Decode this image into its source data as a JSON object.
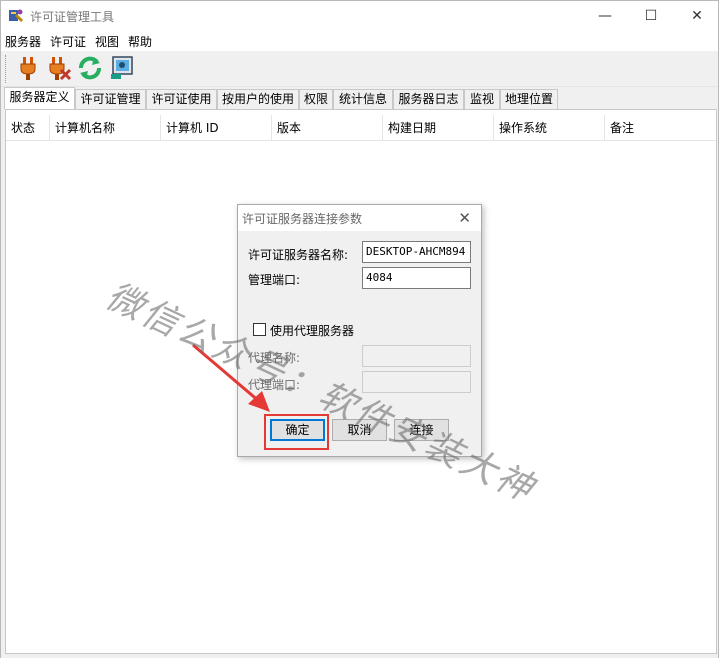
{
  "window": {
    "title": "许可证管理工具",
    "min_glyph": "—",
    "max_glyph": "☐",
    "close_glyph": "✕"
  },
  "menu": {
    "items": [
      "服务器",
      "许可证",
      "视图",
      "帮助"
    ]
  },
  "toolbar": {
    "buttons": [
      "plug-connect-icon",
      "plug-disconnect-icon",
      "refresh-icon",
      "settings-monitor-icon"
    ]
  },
  "tabs": {
    "items": [
      "服务器定义",
      "许可证管理",
      "许可证使用",
      "按用户的使用",
      "权限",
      "统计信息",
      "服务器日志",
      "监视",
      "地理位置"
    ],
    "active": "服务器定义"
  },
  "list": {
    "columns": [
      "状态",
      "计算机名称",
      "计算机 ID",
      "版本",
      "构建日期",
      "操作系统",
      "备注"
    ]
  },
  "watermark": "微信公众号：软件安装大神",
  "dialog": {
    "title": "许可证服务器连接参数",
    "close_glyph": "✕",
    "server_name_label": "许可证服务器名称:",
    "server_name_value": "DESKTOP-AHCM894",
    "port_label": "管理端口:",
    "port_value": "4084",
    "use_proxy_label": "使用代理服务器",
    "proxy_name_label": "代理名称:",
    "proxy_port_label": "代理端口:",
    "ok_label": "确定",
    "cancel_label": "取消",
    "connect_label": "连接"
  },
  "colors": {
    "highlight": "#e53935",
    "accent": "#0078d7"
  }
}
